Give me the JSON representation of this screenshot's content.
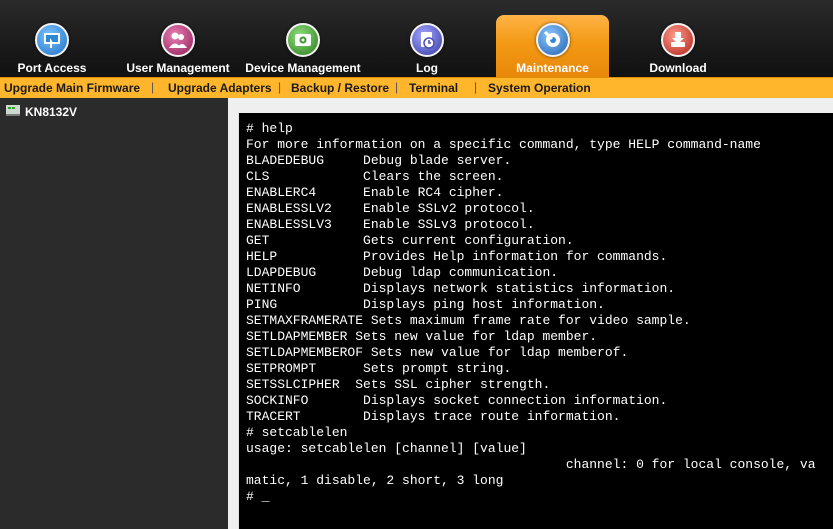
{
  "toolbar": {
    "items": [
      {
        "label": "Port Access",
        "icon": "port-access-icon",
        "color": "#2e86d6"
      },
      {
        "label": "User Management",
        "icon": "users-icon",
        "color": "#b0306f"
      },
      {
        "label": "Device Management",
        "icon": "device-icon",
        "color": "#3a9b2e"
      },
      {
        "label": "Log",
        "icon": "log-icon",
        "color": "#4a4fb8"
      },
      {
        "label": "Maintenance",
        "icon": "maintenance-icon",
        "color": "#2e86d6"
      },
      {
        "label": "Download",
        "icon": "download-icon",
        "color": "#d63a2e"
      }
    ],
    "active": "Maintenance"
  },
  "submenu": {
    "items": [
      "Upgrade Main Firmware",
      "Upgrade Adapters",
      "Backup / Restore",
      "Terminal",
      "System Operation"
    ],
    "active": "Terminal",
    "separator": "|"
  },
  "sidebar": {
    "tree_root": "KN8132V"
  },
  "terminal": {
    "lines": [
      "# help",
      "For more information on a specific command, type HELP command-name",
      "BLADEDEBUG     Debug blade server.",
      "CLS            Clears the screen.",
      "ENABLERC4      Enable RC4 cipher.",
      "ENABLESSLV2    Enable SSLv2 protocol.",
      "ENABLESSLV3    Enable SSLv3 protocol.",
      "GET            Gets current configuration.",
      "HELP           Provides Help information for commands.",
      "LDAPDEBUG      Debug ldap communication.",
      "NETINFO        Displays network statistics information.",
      "PING           Displays ping host information.",
      "SETMAXFRAMERATE Sets maximum frame rate for video sample.",
      "SETLDAPMEMBER Sets new value for ldap member.",
      "SETLDAPMEMBEROF Sets new value for ldap memberof.",
      "SETPROMPT      Sets prompt string.",
      "SETSSLCIPHER  Sets SSL cipher strength.",
      "SOCKINFO       Displays socket connection information.",
      "TRACERT        Displays trace route information.",
      "# setcablelen",
      "usage: setcablelen [channel] [value]",
      "                                         channel: 0 for local console, va",
      "matic, 1 disable, 2 short, 3 long",
      "# _"
    ]
  }
}
